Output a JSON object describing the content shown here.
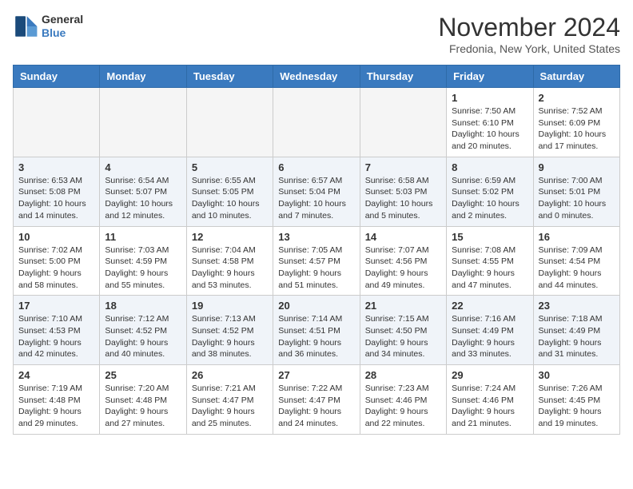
{
  "header": {
    "logo_line1": "General",
    "logo_line2": "Blue",
    "month": "November 2024",
    "location": "Fredonia, New York, United States"
  },
  "weekdays": [
    "Sunday",
    "Monday",
    "Tuesday",
    "Wednesday",
    "Thursday",
    "Friday",
    "Saturday"
  ],
  "weeks": [
    [
      {
        "day": "",
        "info": ""
      },
      {
        "day": "",
        "info": ""
      },
      {
        "day": "",
        "info": ""
      },
      {
        "day": "",
        "info": ""
      },
      {
        "day": "",
        "info": ""
      },
      {
        "day": "1",
        "info": "Sunrise: 7:50 AM\nSunset: 6:10 PM\nDaylight: 10 hours\nand 20 minutes."
      },
      {
        "day": "2",
        "info": "Sunrise: 7:52 AM\nSunset: 6:09 PM\nDaylight: 10 hours\nand 17 minutes."
      }
    ],
    [
      {
        "day": "3",
        "info": "Sunrise: 6:53 AM\nSunset: 5:08 PM\nDaylight: 10 hours\nand 14 minutes."
      },
      {
        "day": "4",
        "info": "Sunrise: 6:54 AM\nSunset: 5:07 PM\nDaylight: 10 hours\nand 12 minutes."
      },
      {
        "day": "5",
        "info": "Sunrise: 6:55 AM\nSunset: 5:05 PM\nDaylight: 10 hours\nand 10 minutes."
      },
      {
        "day": "6",
        "info": "Sunrise: 6:57 AM\nSunset: 5:04 PM\nDaylight: 10 hours\nand 7 minutes."
      },
      {
        "day": "7",
        "info": "Sunrise: 6:58 AM\nSunset: 5:03 PM\nDaylight: 10 hours\nand 5 minutes."
      },
      {
        "day": "8",
        "info": "Sunrise: 6:59 AM\nSunset: 5:02 PM\nDaylight: 10 hours\nand 2 minutes."
      },
      {
        "day": "9",
        "info": "Sunrise: 7:00 AM\nSunset: 5:01 PM\nDaylight: 10 hours\nand 0 minutes."
      }
    ],
    [
      {
        "day": "10",
        "info": "Sunrise: 7:02 AM\nSunset: 5:00 PM\nDaylight: 9 hours\nand 58 minutes."
      },
      {
        "day": "11",
        "info": "Sunrise: 7:03 AM\nSunset: 4:59 PM\nDaylight: 9 hours\nand 55 minutes."
      },
      {
        "day": "12",
        "info": "Sunrise: 7:04 AM\nSunset: 4:58 PM\nDaylight: 9 hours\nand 53 minutes."
      },
      {
        "day": "13",
        "info": "Sunrise: 7:05 AM\nSunset: 4:57 PM\nDaylight: 9 hours\nand 51 minutes."
      },
      {
        "day": "14",
        "info": "Sunrise: 7:07 AM\nSunset: 4:56 PM\nDaylight: 9 hours\nand 49 minutes."
      },
      {
        "day": "15",
        "info": "Sunrise: 7:08 AM\nSunset: 4:55 PM\nDaylight: 9 hours\nand 47 minutes."
      },
      {
        "day": "16",
        "info": "Sunrise: 7:09 AM\nSunset: 4:54 PM\nDaylight: 9 hours\nand 44 minutes."
      }
    ],
    [
      {
        "day": "17",
        "info": "Sunrise: 7:10 AM\nSunset: 4:53 PM\nDaylight: 9 hours\nand 42 minutes."
      },
      {
        "day": "18",
        "info": "Sunrise: 7:12 AM\nSunset: 4:52 PM\nDaylight: 9 hours\nand 40 minutes."
      },
      {
        "day": "19",
        "info": "Sunrise: 7:13 AM\nSunset: 4:52 PM\nDaylight: 9 hours\nand 38 minutes."
      },
      {
        "day": "20",
        "info": "Sunrise: 7:14 AM\nSunset: 4:51 PM\nDaylight: 9 hours\nand 36 minutes."
      },
      {
        "day": "21",
        "info": "Sunrise: 7:15 AM\nSunset: 4:50 PM\nDaylight: 9 hours\nand 34 minutes."
      },
      {
        "day": "22",
        "info": "Sunrise: 7:16 AM\nSunset: 4:49 PM\nDaylight: 9 hours\nand 33 minutes."
      },
      {
        "day": "23",
        "info": "Sunrise: 7:18 AM\nSunset: 4:49 PM\nDaylight: 9 hours\nand 31 minutes."
      }
    ],
    [
      {
        "day": "24",
        "info": "Sunrise: 7:19 AM\nSunset: 4:48 PM\nDaylight: 9 hours\nand 29 minutes."
      },
      {
        "day": "25",
        "info": "Sunrise: 7:20 AM\nSunset: 4:48 PM\nDaylight: 9 hours\nand 27 minutes."
      },
      {
        "day": "26",
        "info": "Sunrise: 7:21 AM\nSunset: 4:47 PM\nDaylight: 9 hours\nand 25 minutes."
      },
      {
        "day": "27",
        "info": "Sunrise: 7:22 AM\nSunset: 4:47 PM\nDaylight: 9 hours\nand 24 minutes."
      },
      {
        "day": "28",
        "info": "Sunrise: 7:23 AM\nSunset: 4:46 PM\nDaylight: 9 hours\nand 22 minutes."
      },
      {
        "day": "29",
        "info": "Sunrise: 7:24 AM\nSunset: 4:46 PM\nDaylight: 9 hours\nand 21 minutes."
      },
      {
        "day": "30",
        "info": "Sunrise: 7:26 AM\nSunset: 4:45 PM\nDaylight: 9 hours\nand 19 minutes."
      }
    ]
  ]
}
